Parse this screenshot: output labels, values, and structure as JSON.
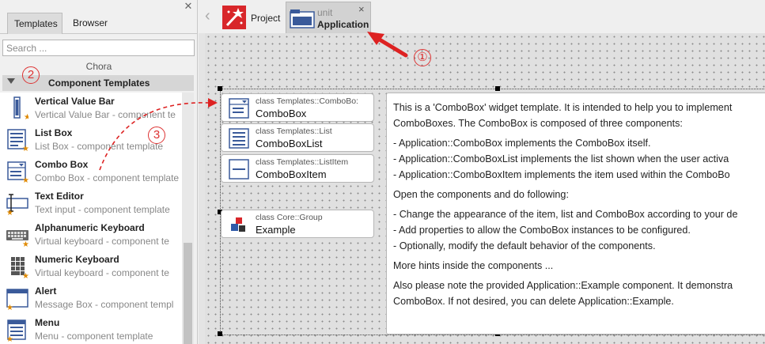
{
  "left_panel": {
    "tabs": [
      {
        "label": "Templates",
        "active": true
      },
      {
        "label": "Browser",
        "active": false
      }
    ],
    "search": {
      "placeholder": "Search ...",
      "value": ""
    },
    "folder": "Chora",
    "group_title": "Component Templates",
    "items": [
      {
        "name": "Vertical Value Bar",
        "desc": "Vertical Value Bar -  component te",
        "icon": "vertical-value-bar-icon"
      },
      {
        "name": "List Box",
        "desc": "List Box -  component template",
        "icon": "list-box-icon"
      },
      {
        "name": "Combo Box",
        "desc": "Combo Box -  component template",
        "icon": "combo-box-icon"
      },
      {
        "name": "Text Editor",
        "desc": "Text input - component template",
        "icon": "text-editor-icon"
      },
      {
        "name": "Alphanumeric Keyboard",
        "desc": "Virtual keyboard -  component te",
        "icon": "keyboard-icon"
      },
      {
        "name": "Numeric Keyboard",
        "desc": "Virtual keyboard - component te",
        "icon": "numeric-keyboard-icon"
      },
      {
        "name": "Alert",
        "desc": "Message Box -  component templ",
        "icon": "alert-icon"
      },
      {
        "name": "Menu",
        "desc": "Menu -  component template",
        "icon": "menu-icon"
      }
    ]
  },
  "editor": {
    "tabs": {
      "project": {
        "label": "Project"
      },
      "application": {
        "kind": "unit",
        "name": "Application",
        "close": "×"
      }
    },
    "bricks": [
      {
        "class": "class Templates::ComboBo:",
        "name": "ComboBox",
        "icon": "combo-box-icon"
      },
      {
        "class": "class Templates::List",
        "name": "ComboBoxList",
        "icon": "list-box-icon"
      },
      {
        "class": "class Templates::ListItem",
        "name": "ComboBoxItem",
        "icon": "list-item-icon"
      },
      {
        "class": "class Core::Group",
        "name": "Example",
        "icon": "group-icon"
      }
    ],
    "annotation": [
      "This is a 'ComboBox' widget template. It is intended to help you to implement",
      "ComboBoxes. The ComboBox is composed of three components:",
      "",
      "- Application::ComboBox implements the ComboBox itself.",
      "- Application::ComboBoxList implements the list shown when the user activa",
      "- Application::ComboBoxItem implements the item used within the ComboBo",
      "",
      "Open the components and do following:",
      "",
      "- Change the appearance of the item, list and ComboBox according to your de",
      "- Add properties to allow the ComboBox instances to be configured.",
      "- Optionally, modify the default behavior of the components.",
      "",
      "More hints inside the components ...",
      "",
      "Also please note the provided Application::Example component. It demonstra",
      "ComboBox. If not desired, you can delete Application::Example."
    ]
  },
  "callouts": [
    "①",
    "2",
    "3"
  ],
  "colors": {
    "callout": "#dd2222",
    "icon_blue": "#3a5a9a",
    "accent_star": "#e08a00"
  }
}
